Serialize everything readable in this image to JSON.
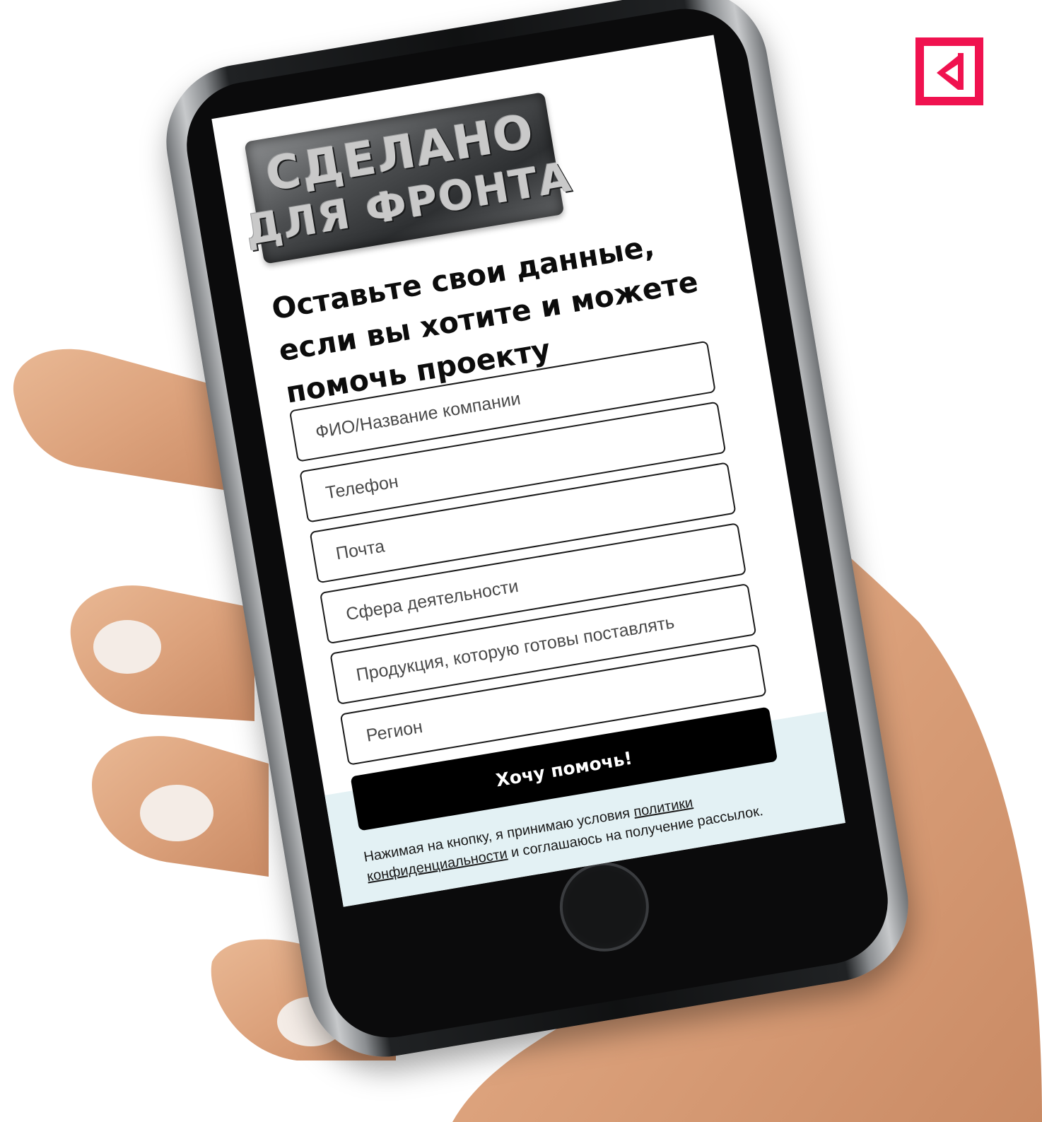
{
  "brand": {
    "accent_color": "#f0124f",
    "logo_icon": "bracket-arrow-icon"
  },
  "hero": {
    "stamp_line_1": "СДЕЛАНО",
    "stamp_line_2": "ДЛЯ ФРОНТА"
  },
  "form": {
    "headline": "Оставьте свои данные, если вы хотите и можете помочь проекту",
    "fields": [
      {
        "placeholder": "ФИО/Название компании"
      },
      {
        "placeholder": "Телефон"
      },
      {
        "placeholder": "Почта"
      },
      {
        "placeholder": "Сфера деятельности"
      },
      {
        "placeholder": "Продукция, которую готовы поставлять"
      },
      {
        "placeholder": "Регион"
      }
    ],
    "submit_label": "Хочу помочь!",
    "consent_prefix": "Нажимая на кнопку, я принимаю условия",
    "consent_link": "политики конфиденциальности",
    "consent_suffix": "и соглашаюсь на получение рассылок."
  }
}
